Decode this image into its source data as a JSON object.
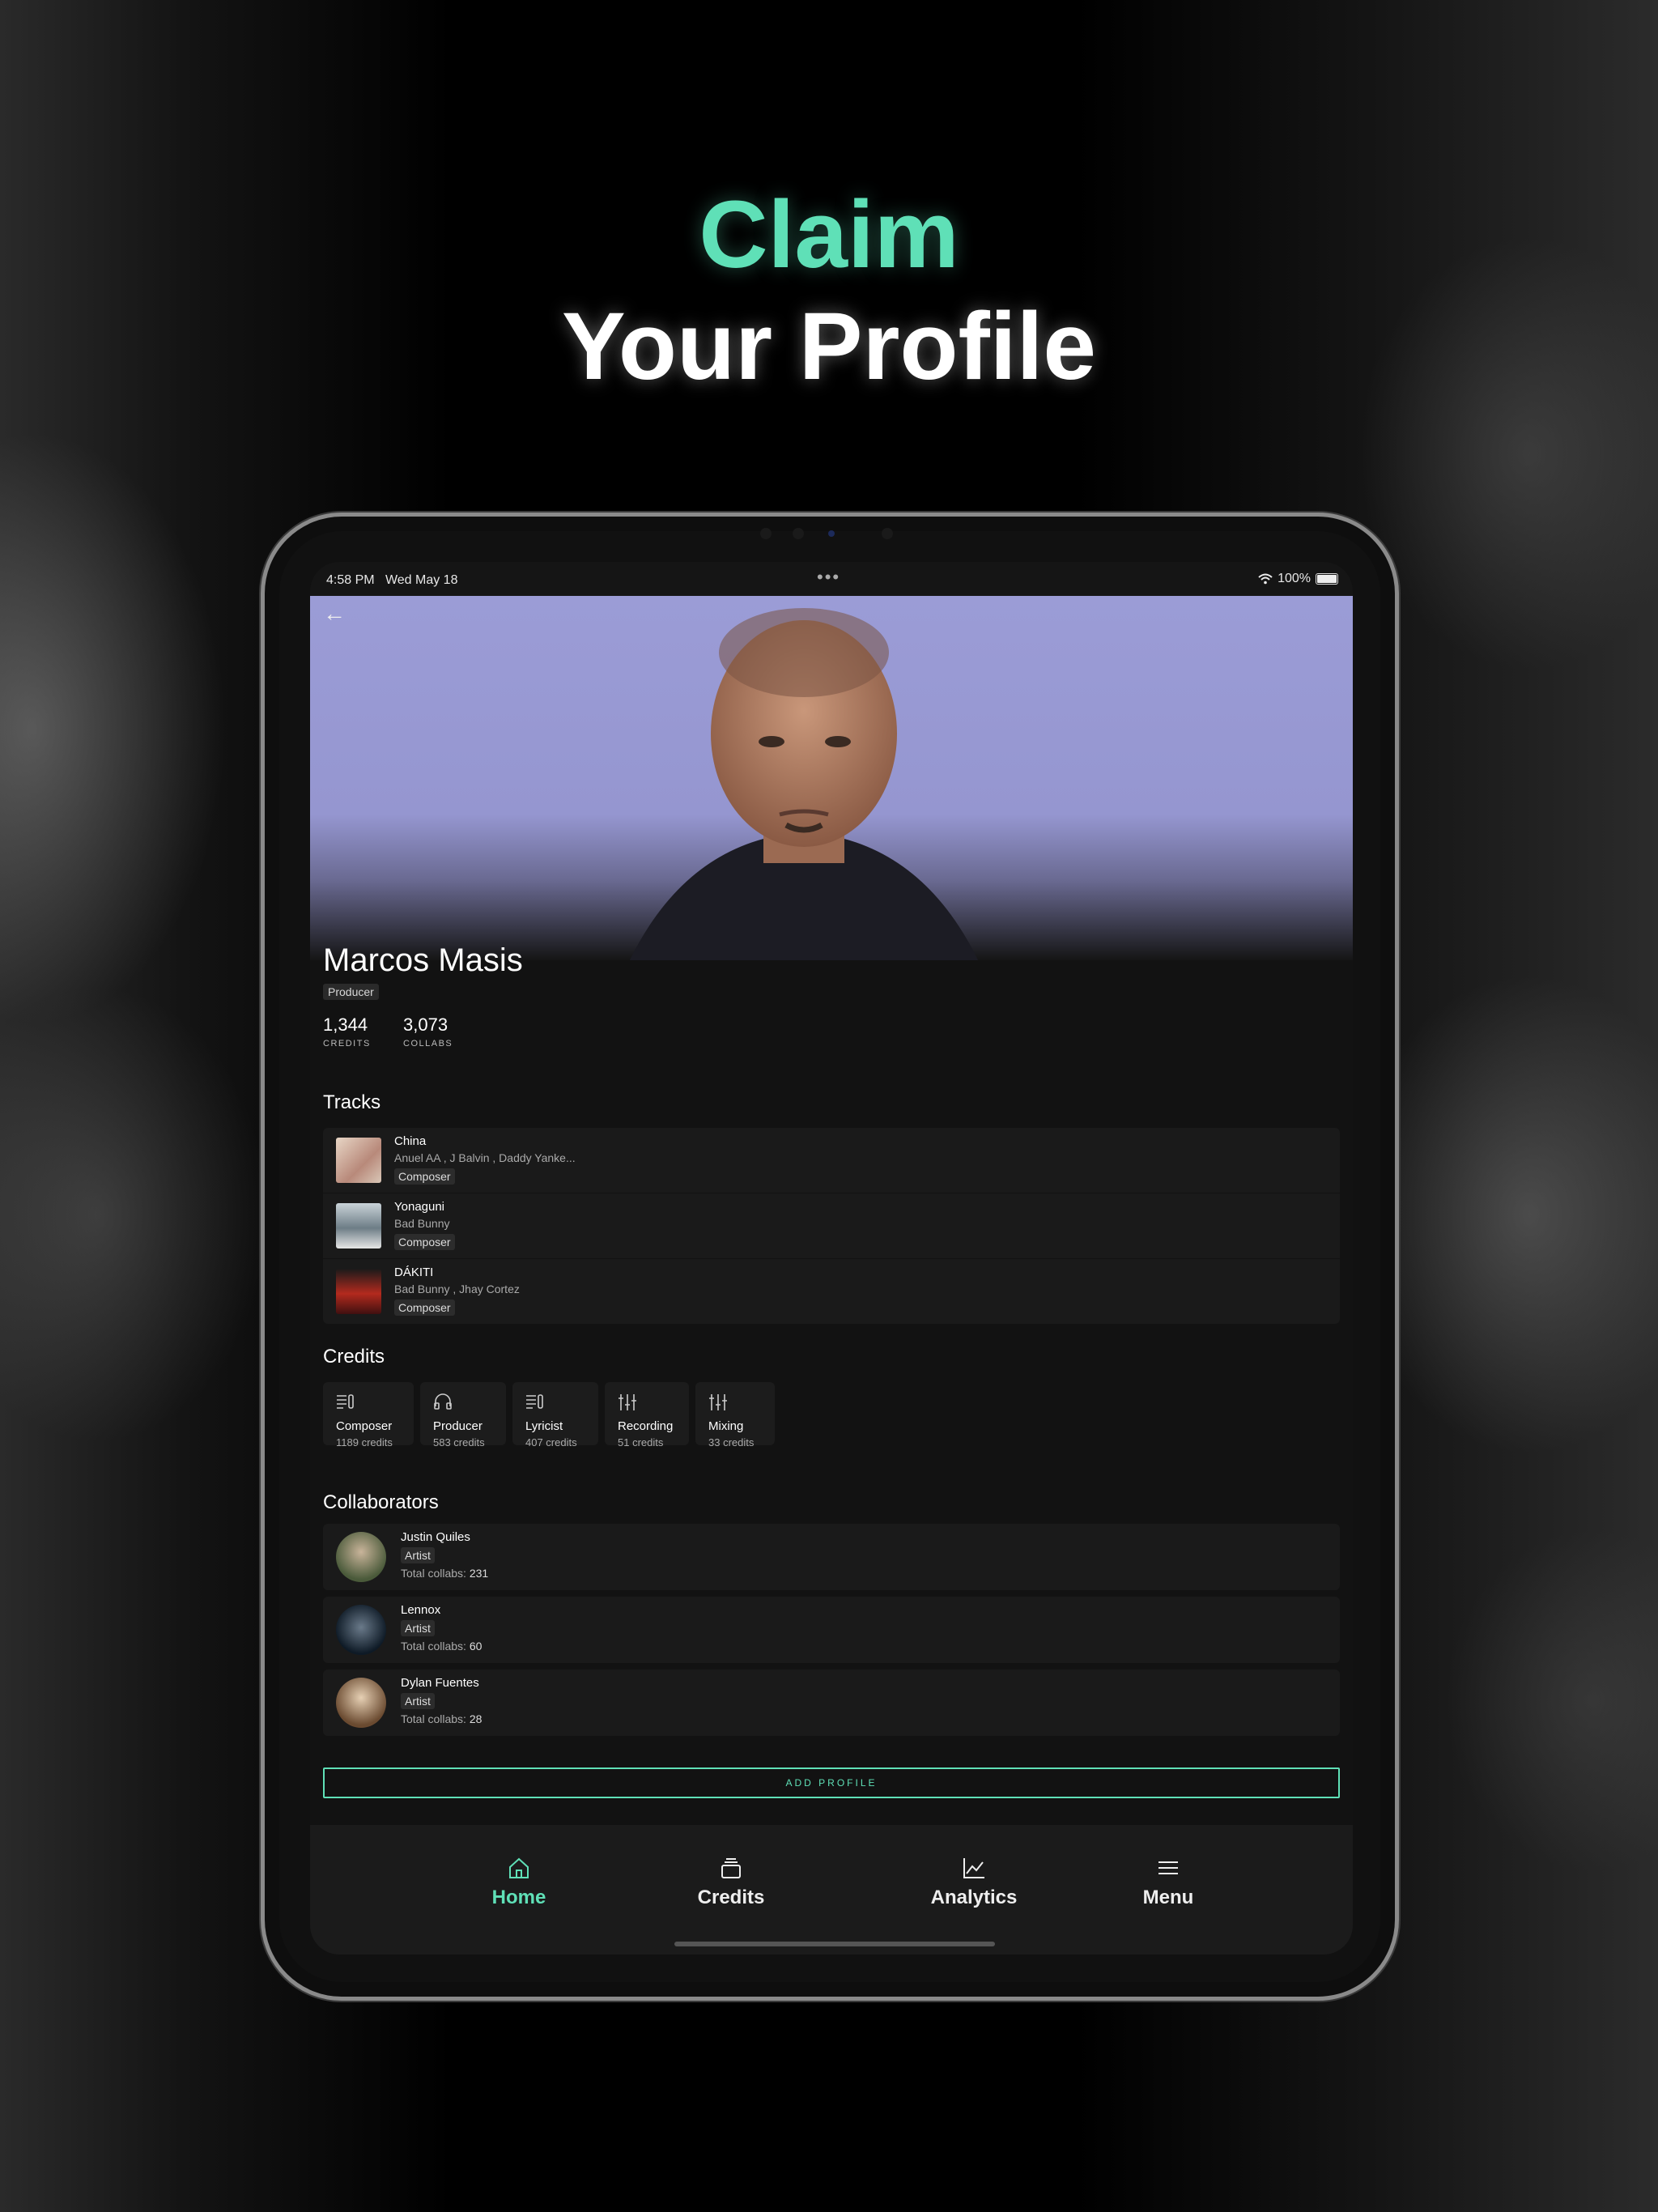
{
  "headline": {
    "line1": "Claim",
    "line2": "Your Profile"
  },
  "status_bar": {
    "time": "4:58 PM",
    "date": "Wed May 18",
    "dots": "•••",
    "battery": "100%"
  },
  "profile": {
    "name": "Marcos Masis",
    "role": "Producer",
    "stats": [
      {
        "value": "1,344",
        "label": "CREDITS"
      },
      {
        "value": "3,073",
        "label": "COLLABS"
      }
    ]
  },
  "tracks": {
    "title": "Tracks",
    "items": [
      {
        "title": "China",
        "artists": "Anuel AA , J Balvin , Daddy Yanke...",
        "tag": "Composer"
      },
      {
        "title": "Yonaguni",
        "artists": "Bad Bunny",
        "tag": "Composer"
      },
      {
        "title": "DÁKITI",
        "artists": "Bad Bunny , Jhay Cortez",
        "tag": "Composer"
      }
    ]
  },
  "credits": {
    "title": "Credits",
    "items": [
      {
        "name": "Composer",
        "count": "1189 credits",
        "icon": "composer-icon"
      },
      {
        "name": "Producer",
        "count": "583 credits",
        "icon": "headphones-icon"
      },
      {
        "name": "Lyricist",
        "count": "407 credits",
        "icon": "lyricist-icon"
      },
      {
        "name": "Recording",
        "count": "51 credits",
        "icon": "sliders-icon"
      },
      {
        "name": "Mixing",
        "count": "33 credits",
        "icon": "sliders-icon"
      }
    ]
  },
  "collaborators": {
    "title": "Collaborators",
    "items": [
      {
        "name": "Justin Quiles",
        "tag": "Artist",
        "total_label": "Total collabs:",
        "total": "231"
      },
      {
        "name": "Lennox",
        "tag": "Artist",
        "total_label": "Total collabs:",
        "total": "60"
      },
      {
        "name": "Dylan Fuentes",
        "tag": "Artist",
        "total_label": "Total collabs:",
        "total": "28"
      }
    ]
  },
  "add_profile_label": "ADD PROFILE",
  "tabs": [
    {
      "label": "Home",
      "icon": "home-icon",
      "active": true
    },
    {
      "label": "Credits",
      "icon": "credits-icon",
      "active": false
    },
    {
      "label": "Analytics",
      "icon": "analytics-icon",
      "active": false
    },
    {
      "label": "Menu",
      "icon": "menu-icon",
      "active": false
    }
  ],
  "colors": {
    "accent": "#5fe0b7",
    "background": "#121212",
    "hero": "#9b9cd6"
  }
}
